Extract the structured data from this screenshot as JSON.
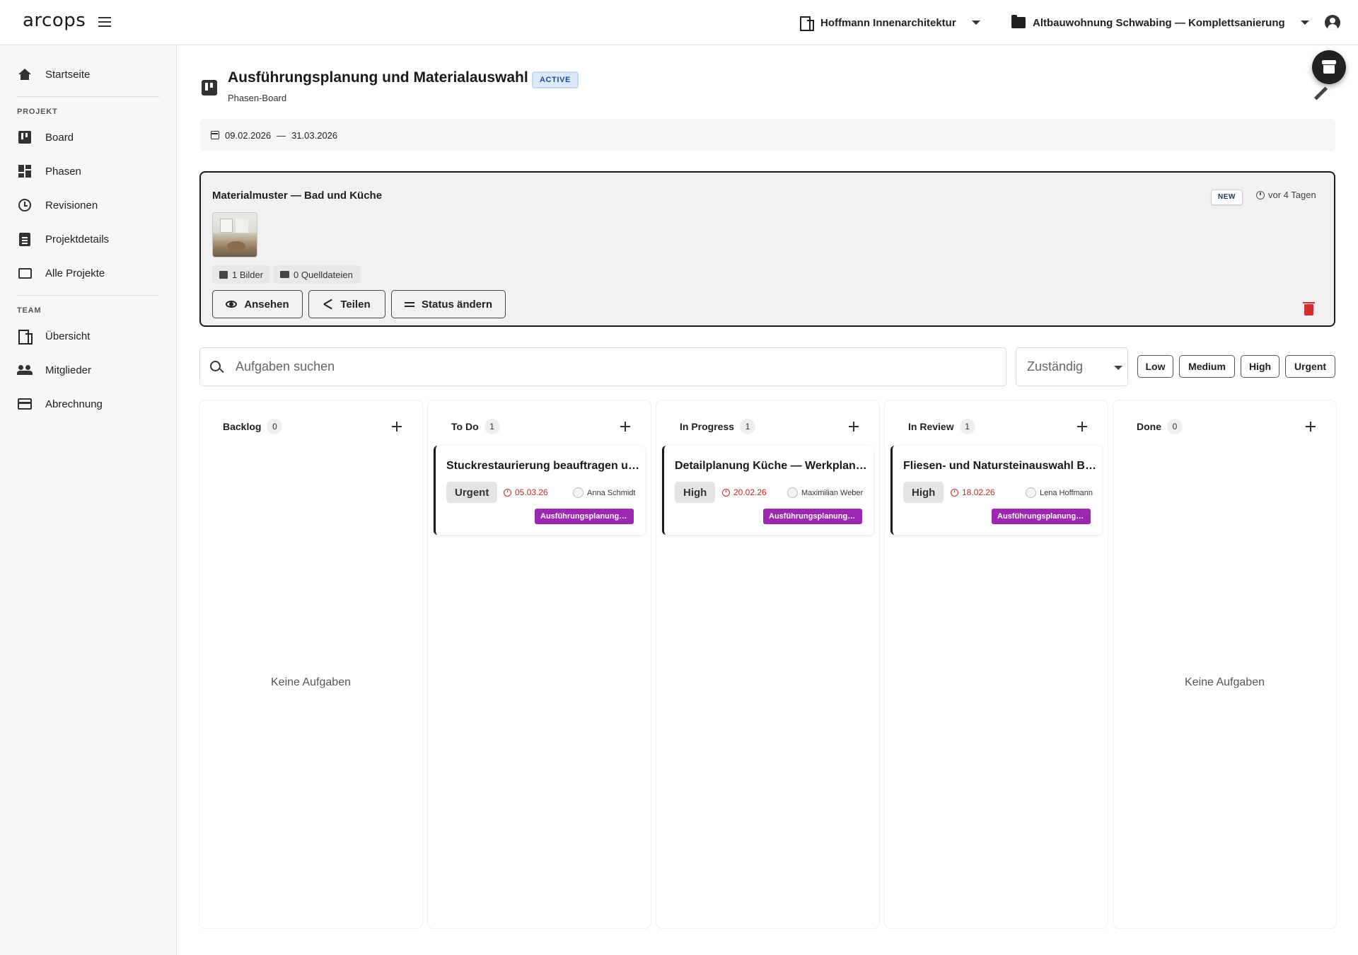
{
  "app": {
    "logo": "arcops"
  },
  "topbar": {
    "organization": "Hoffmann Innenarchitektur",
    "project": "Altbauwohnung Schwabing — Komplettsanierung"
  },
  "sidebar": {
    "home": "Startseite",
    "section_project": "PROJEKT",
    "project_items": [
      "Board",
      "Phasen",
      "Revisionen",
      "Projektdetails",
      "Alle Projekte"
    ],
    "section_team": "TEAM",
    "team_items": [
      "Übersicht",
      "Mitglieder",
      "Abrechnung"
    ]
  },
  "page": {
    "title": "Ausführungsplanung und Materialauswahl",
    "status": "ACTIVE",
    "subtitle": "Phasen-Board",
    "date_start": "09.02.2026",
    "date_sep": "—",
    "date_end": "31.03.2026"
  },
  "featured": {
    "title": "Materialmuster — Bad und Küche",
    "badge": "NEW",
    "time_ago": "vor 4 Tagen",
    "images": "1 Bilder",
    "sources": "0 Quelldateien",
    "btn_view": "Ansehen",
    "btn_share": "Teilen",
    "btn_status": "Status ändern"
  },
  "filters": {
    "search_placeholder": "Aufgaben suchen",
    "assignee_placeholder": "Zuständig",
    "priorities": [
      "Low",
      "Medium",
      "High",
      "Urgent"
    ]
  },
  "board": {
    "empty_label": "Keine Aufgaben",
    "columns": [
      {
        "name": "Backlog",
        "count": "0"
      },
      {
        "name": "To Do",
        "count": "1",
        "card": {
          "title": "Stuckrestaurierung beauftragen und Termin koordinieren",
          "priority": "Urgent",
          "due": "05.03.26",
          "assignee": "Anna Schmidt",
          "phase": "Ausführungsplanung und Materialauswahl"
        }
      },
      {
        "name": "In Progress",
        "count": "1",
        "card": {
          "title": "Detailplanung Küche — Werkplanung Einbauten",
          "priority": "High",
          "due": "20.02.26",
          "assignee": "Maximilian Weber",
          "phase": "Ausführungsplanung und Materialauswahl"
        }
      },
      {
        "name": "In Review",
        "count": "1",
        "card": {
          "title": "Fliesen- und Natursteinauswahl Bad",
          "priority": "High",
          "due": "18.02.26",
          "assignee": "Lena Hoffmann",
          "phase": "Ausführungsplanung und Materialauswahl"
        }
      },
      {
        "name": "Done",
        "count": "0"
      }
    ]
  },
  "colors": {
    "phase_tag": "#9c27b0",
    "due": "#c62828",
    "delete": "#d32f2f",
    "active_badge": "#dbe9fb"
  }
}
